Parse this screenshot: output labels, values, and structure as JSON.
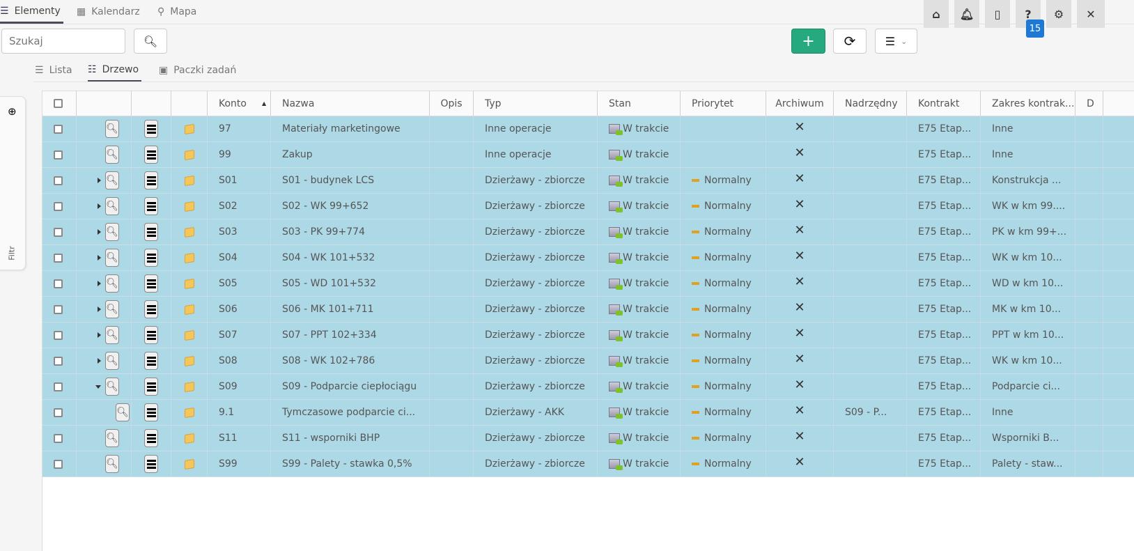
{
  "top_tabs": [
    {
      "label": "Elementy",
      "icon": "list-icon"
    },
    {
      "label": "Kalendarz",
      "icon": "calendar-icon"
    },
    {
      "label": "Mapa",
      "icon": "map-marker-icon"
    }
  ],
  "top_buttons": {
    "icons": [
      "home-icon",
      "bell-icon",
      "mobile-icon",
      "help-icon",
      "gear-icon",
      "close-icon"
    ],
    "help_badge": "15",
    "badge_color": "#1e78d6"
  },
  "search": {
    "placeholder": "Szukaj"
  },
  "toolbar": {
    "add_color": "#26a97f",
    "add_label": "+"
  },
  "sub_tabs": [
    {
      "label": "Lista",
      "icon": "list-icon"
    },
    {
      "label": "Drzewo",
      "icon": "tree-icon"
    },
    {
      "label": "Paczki zadań",
      "icon": "package-icon"
    }
  ],
  "filter_label": "Filtr",
  "columns": [
    "Konto",
    "Nazwa",
    "Opis",
    "Typ",
    "Stan",
    "Priorytet",
    "Archiwum",
    "Nadrzędny",
    "Kontrakt",
    "Zakres kontrak...",
    "D"
  ],
  "row_color": "#add8e6",
  "rows": [
    {
      "expand": "none",
      "konto": "97",
      "nazwa": "Materiały marketingowe",
      "opis": "",
      "typ": "Inne operacje",
      "stan": "W trakcie",
      "priorytet": "",
      "archiwum": "✕",
      "nadrzedny": "",
      "kontrakt": "E75 Etap...",
      "zakres": "Inne"
    },
    {
      "expand": "none",
      "konto": "99",
      "nazwa": "Zakup",
      "opis": "",
      "typ": "Inne operacje",
      "stan": "W trakcie",
      "priorytet": "",
      "archiwum": "✕",
      "nadrzedny": "",
      "kontrakt": "E75 Etap...",
      "zakres": "Inne"
    },
    {
      "expand": "collapsed",
      "konto": "S01",
      "nazwa": "S01 - budynek LCS",
      "opis": "",
      "typ": "Dzierżawy - zbiorcze",
      "stan": "W trakcie",
      "priorytet": "Normalny",
      "archiwum": "✕",
      "nadrzedny": "",
      "kontrakt": "E75 Etap...",
      "zakres": "Konstrukcja ..."
    },
    {
      "expand": "collapsed",
      "konto": "S02",
      "nazwa": "S02 - WK 99+652",
      "opis": "",
      "typ": "Dzierżawy - zbiorcze",
      "stan": "W trakcie",
      "priorytet": "Normalny",
      "archiwum": "✕",
      "nadrzedny": "",
      "kontrakt": "E75 Etap...",
      "zakres": "WK w km 99...."
    },
    {
      "expand": "collapsed",
      "konto": "S03",
      "nazwa": "S03 - PK 99+774",
      "opis": "",
      "typ": "Dzierżawy - zbiorcze",
      "stan": "W trakcie",
      "priorytet": "Normalny",
      "archiwum": "✕",
      "nadrzedny": "",
      "kontrakt": "E75 Etap...",
      "zakres": "PK w km 99+..."
    },
    {
      "expand": "collapsed",
      "konto": "S04",
      "nazwa": "S04 - WK 101+532",
      "opis": "",
      "typ": "Dzierżawy - zbiorcze",
      "stan": "W trakcie",
      "priorytet": "Normalny",
      "archiwum": "✕",
      "nadrzedny": "",
      "kontrakt": "E75 Etap...",
      "zakres": "WK w km 10..."
    },
    {
      "expand": "collapsed",
      "konto": "S05",
      "nazwa": "S05 - WD 101+532",
      "opis": "",
      "typ": "Dzierżawy - zbiorcze",
      "stan": "W trakcie",
      "priorytet": "Normalny",
      "archiwum": "✕",
      "nadrzedny": "",
      "kontrakt": "E75 Etap...",
      "zakres": "WD w km 10..."
    },
    {
      "expand": "collapsed",
      "konto": "S06",
      "nazwa": "S06 - MK 101+711",
      "opis": "",
      "typ": "Dzierżawy - zbiorcze",
      "stan": "W trakcie",
      "priorytet": "Normalny",
      "archiwum": "✕",
      "nadrzedny": "",
      "kontrakt": "E75 Etap...",
      "zakres": "MK w km 10..."
    },
    {
      "expand": "collapsed",
      "konto": "S07",
      "nazwa": "S07 - PPT 102+334",
      "opis": "",
      "typ": "Dzierżawy - zbiorcze",
      "stan": "W trakcie",
      "priorytet": "Normalny",
      "archiwum": "✕",
      "nadrzedny": "",
      "kontrakt": "E75 Etap...",
      "zakres": "PPT w km 10..."
    },
    {
      "expand": "collapsed",
      "konto": "S08",
      "nazwa": "S08 - WK 102+786",
      "opis": "",
      "typ": "Dzierżawy - zbiorcze",
      "stan": "W trakcie",
      "priorytet": "Normalny",
      "archiwum": "✕",
      "nadrzedny": "",
      "kontrakt": "E75 Etap...",
      "zakres": "WK w km 10..."
    },
    {
      "expand": "expanded",
      "konto": "S09",
      "nazwa": "S09 - Podparcie ciepłociągu",
      "opis": "",
      "typ": "Dzierżawy - zbiorcze",
      "stan": "W trakcie",
      "priorytet": "Normalny",
      "archiwum": "✕",
      "nadrzedny": "",
      "kontrakt": "E75 Etap...",
      "zakres": "Podparcie ci..."
    },
    {
      "expand": "child",
      "konto": "9.1",
      "nazwa": "Tymczasowe podparcie ci...",
      "opis": "",
      "typ": "Dzierżawy - AKK",
      "stan": "W trakcie",
      "priorytet": "Normalny",
      "archiwum": "✕",
      "nadrzedny": "S09 - P...",
      "kontrakt": "E75 Etap...",
      "zakres": "Inne"
    },
    {
      "expand": "none",
      "konto": "S11",
      "nazwa": "S11 - wsporniki BHP",
      "opis": "",
      "typ": "Dzierżawy - zbiorcze",
      "stan": "W trakcie",
      "priorytet": "Normalny",
      "archiwum": "✕",
      "nadrzedny": "",
      "kontrakt": "E75 Etap...",
      "zakres": "Wsporniki B..."
    },
    {
      "expand": "none",
      "konto": "S99",
      "nazwa": "S99 - Palety - stawka 0,5%",
      "opis": "",
      "typ": "Dzierżawy - zbiorcze",
      "stan": "W trakcie",
      "priorytet": "Normalny",
      "archiwum": "✕",
      "nadrzedny": "",
      "kontrakt": "E75 Etap...",
      "zakres": "Palety - staw..."
    }
  ]
}
